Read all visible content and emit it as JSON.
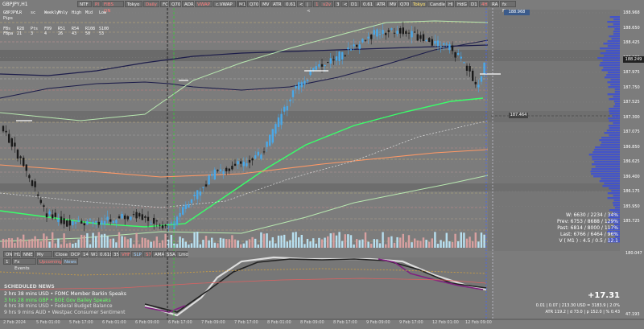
{
  "window": {
    "symbol": "GBPJPY,H1"
  },
  "toolbar": [
    {
      "label": "NTF",
      "style": ""
    },
    {
      "label": "PI",
      "style": "red"
    },
    {
      "label": "FIBS ON",
      "style": "red"
    },
    {
      "label": "Tokyo",
      "style": ""
    },
    {
      "label": "Daily",
      "style": "red"
    },
    {
      "label": "FC",
      "style": ""
    },
    {
      "label": "Q70",
      "style": ""
    },
    {
      "label": "ADR",
      "style": ""
    },
    {
      "label": "VWAP",
      "style": "red"
    },
    {
      "label": "c.VWAP",
      "style": ""
    },
    {
      "label": "M1",
      "style": "active"
    },
    {
      "label": "Q70",
      "style": ""
    },
    {
      "label": "MV",
      "style": ""
    },
    {
      "label": "ATR",
      "style": ""
    },
    {
      "label": "0.61",
      "style": ""
    },
    {
      "label": "<",
      "style": ""
    },
    {
      "label": "|<",
      "style": ""
    },
    {
      "label": "1",
      "style": "red"
    },
    {
      "label": "v2v",
      "style": "red"
    },
    {
      "label": "3",
      "style": ""
    },
    {
      "label": "<",
      "style": ""
    },
    {
      "label": "D1",
      "style": ""
    },
    {
      "label": "0.61",
      "style": ""
    },
    {
      "label": "ATR",
      "style": ""
    },
    {
      "label": "MV",
      "style": ""
    },
    {
      "label": "Q70",
      "style": ""
    },
    {
      "label": "Tokyo",
      "style": "yellow"
    },
    {
      "label": "Candle",
      "style": ""
    },
    {
      "label": "Hl",
      "style": ""
    },
    {
      "label": "HdG",
      "style": ""
    },
    {
      "label": "D1",
      "style": ""
    },
    {
      "label": "4H",
      "style": "red"
    },
    {
      "label": "RA",
      "style": ""
    },
    {
      "label": "fx Fix",
      "style": ""
    }
  ],
  "info_table": {
    "headers": [
      "GBPJPY",
      "LR",
      "sc",
      "Weekly",
      "Mnly",
      "High",
      "Mid",
      "Low"
    ],
    "rows": [
      [
        "Pips",
        "",
        "",
        "",
        "",
        "",
        "",
        ""
      ],
      [
        "",
        "",
        "",
        "",
        "",
        "",
        "",
        ""
      ],
      [
        "FBs",
        "R28",
        "Pts",
        "F09",
        "R51",
        "R54",
        "R108",
        "S100"
      ],
      [
        "FBpa",
        "21",
        "3",
        "4",
        "26",
        "43",
        "50",
        "53"
      ]
    ]
  },
  "price_labels": [
    {
      "text": "188.968",
      "color": "#ffffff"
    },
    {
      "text": "188.650",
      "color": "#ffffff"
    },
    {
      "text": "188.425",
      "color": "#ffffff"
    },
    {
      "text": "188.200",
      "color": "#ffffff"
    },
    {
      "text": "187.975",
      "color": "#ffffff"
    },
    {
      "text": "187.750",
      "color": "#ffffff"
    },
    {
      "text": "187.525",
      "color": "#ffffff"
    },
    {
      "text": "187.300",
      "color": "#ffffff"
    },
    {
      "text": "187.075",
      "color": "#ffffff"
    },
    {
      "text": "186.850",
      "color": "#ffffff"
    },
    {
      "text": "186.625",
      "color": "#ffffff"
    },
    {
      "text": "186.400",
      "color": "#ffffff"
    },
    {
      "text": "186.175",
      "color": "#ffffff"
    },
    {
      "text": "185.950",
      "color": "#ffffff"
    },
    {
      "text": "185.725",
      "color": "#ffffff"
    }
  ],
  "current_price": "188.249",
  "price_tag": "187.464",
  "top_tag": "188.968",
  "volume_panel": {
    "scale_top": "180.047"
  },
  "panel_tabs": [
    {
      "label": "ON",
      "style": ""
    },
    {
      "label": "H1",
      "style": ""
    },
    {
      "label": "NNE",
      "style": ""
    },
    {
      "label": "My NET",
      "style": ""
    },
    {
      "label": "Close",
      "style": ""
    },
    {
      "label": "DCP",
      "style": ""
    },
    {
      "label": "14",
      "style": ""
    },
    {
      "label": "W1",
      "style": ""
    },
    {
      "label": "0.618",
      "style": ""
    },
    {
      "label": "35",
      "style": ""
    },
    {
      "label": "VHF",
      "style": "red"
    },
    {
      "label": "SLP",
      "style": "blue"
    },
    {
      "label": "S7",
      "style": "red"
    },
    {
      "label": "AMA",
      "style": ""
    },
    {
      "label": "SSA",
      "style": ""
    },
    {
      "label": "Lmd",
      "style": ""
    }
  ],
  "panel_tabs2": [
    {
      "label": "1",
      "style": ""
    },
    {
      "label": "Fx Events",
      "style": ""
    },
    {
      "label": "Upcoming",
      "style": "red"
    },
    {
      "label": "News",
      "style": "blue"
    }
  ],
  "schedule": {
    "title": "SCHEDULED NEWS",
    "items": [
      {
        "text": "2 hrs 38 mins  USD  • FOMC Member Barkin Speaks",
        "color": "#ffffff"
      },
      {
        "text": "3 hrs 28 mins  GBP  • BOE Gov Bailey Speaks",
        "color": "#66ff66"
      },
      {
        "text": "4 hrs 38 mins  USD  • Federal Budget Balance",
        "color": "#dddddd"
      },
      {
        "text": "9 hrs 9 mins  AUD  • Westpac Consumer Sentiment",
        "color": "#dddddd"
      }
    ]
  },
  "stats_block": {
    "lines": [
      "W: 6630 / 2234 / 34%",
      "Prev: 6753 / 8688 / 129%",
      "Past: 6814 / 8000 / 117%",
      "Last: 6766 / 6464 / 96%",
      "V ( M1 ) : 4.5 / 0.5 / 12.1"
    ]
  },
  "osc_value": "+17.31",
  "osc_sub1": "0.01  |  0.07  |  213.30 USD = 3183.9  |  2.0%",
  "osc_sub2": "ATR 119.2  |  d 73.0  |  p 152.0  |  % 0.43",
  "osc_scale": "47.193",
  "time_axis": [
    "2 Feb 2024",
    "5 Feb 01:00",
    "5 Feb 17:00",
    "6 Feb 01:00",
    "6 Feb 09:00",
    "6 Feb 17:00",
    "7 Feb 09:00",
    "7 Feb 17:00",
    "8 Feb 01:00",
    "8 Feb 09:00",
    "8 Feb 17:00",
    "9 Feb 09:00",
    "9 Feb 17:00",
    "12 Feb 01:00",
    "12 Feb 09:00"
  ],
  "colors": {
    "background": "#7c7c7c",
    "bull": "#4aa8e8",
    "bear": "#1a1a1a",
    "ema_green": "#39ff6a",
    "ema_orange": "#ff9966",
    "ma_dark": "#1c1c4a"
  }
}
